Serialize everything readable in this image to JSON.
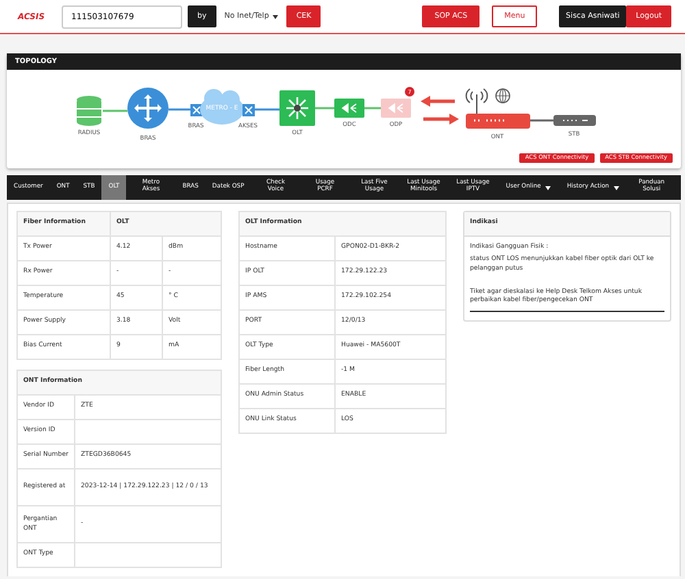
{
  "header": {
    "logo": "ACSIS",
    "search": {
      "value": "111503107679"
    },
    "by_label": "by",
    "select": "No Inet/Telp",
    "check_button": "CEK",
    "sop_button": "SOP ACS",
    "menu_button": "Menu",
    "user": "Sisca Asniwati",
    "logout_button": "Logout"
  },
  "topology": {
    "title": "TOPOLOGY",
    "nodes": [
      {
        "kind": "database",
        "label": "RADIUS",
        "active": true
      },
      {
        "kind": "router",
        "label": "BRAS",
        "active": true
      },
      {
        "kind": "switch",
        "label": "BRAS",
        "active": true
      },
      {
        "kind": "cloud",
        "label": "METRO - E",
        "active": true
      },
      {
        "kind": "switch",
        "label": "AKSES",
        "active": true
      },
      {
        "kind": "olt",
        "label": "OLT",
        "active": true
      },
      {
        "kind": "splitter",
        "label": "ODC",
        "active": true
      },
      {
        "kind": "splitter",
        "label": "ODP",
        "active": false,
        "badge": "7"
      },
      {
        "kind": "ont",
        "label": "ONT",
        "active": true
      },
      {
        "kind": "stb",
        "label": "STB",
        "active": true
      }
    ],
    "buttons": [
      "ACS ONT Connectivity",
      "ACS STB Connectivity"
    ]
  },
  "tabs": [
    {
      "label": "Customer",
      "selected": false,
      "dropdown": false
    },
    {
      "label": "ONT",
      "selected": false,
      "dropdown": false
    },
    {
      "label": "STB",
      "selected": false,
      "dropdown": false
    },
    {
      "label": "OLT",
      "selected": true,
      "dropdown": false
    },
    {
      "label": "Metro Akses",
      "selected": false,
      "dropdown": false
    },
    {
      "label": "BRAS",
      "selected": false,
      "dropdown": false
    },
    {
      "label": "Datek OSP",
      "selected": false,
      "dropdown": false
    },
    {
      "label": "Check Voice",
      "selected": false,
      "dropdown": false
    },
    {
      "label": "Usage PCRF",
      "selected": false,
      "dropdown": false
    },
    {
      "label": "Last Five Usage",
      "selected": false,
      "dropdown": false
    },
    {
      "label": "Last Usage Minitools",
      "selected": false,
      "dropdown": false
    },
    {
      "label": "Last Usage IPTV",
      "selected": false,
      "dropdown": false
    },
    {
      "label": "User Online",
      "selected": false,
      "dropdown": true
    },
    {
      "label": "History Action",
      "selected": false,
      "dropdown": true
    },
    {
      "label": "Panduan Solusi",
      "selected": false,
      "dropdown": false
    }
  ],
  "fiber_information": {
    "title": "Fiber Information",
    "column": "OLT",
    "rows": [
      {
        "label": "Tx Power",
        "value": "4.12",
        "unit": "dBm"
      },
      {
        "label": "Rx Power",
        "value": "-",
        "unit": "-"
      },
      {
        "label": "Temperature",
        "value": "45",
        "unit": "° C"
      },
      {
        "label": "Power Supply",
        "value": "3.18",
        "unit": "Volt"
      },
      {
        "label": "Bias Current",
        "value": "9",
        "unit": "mA"
      }
    ]
  },
  "ont_information": {
    "title": "ONT Information",
    "rows": [
      {
        "label": "Vendor ID",
        "value": "ZTE"
      },
      {
        "label": "Version ID",
        "value": ""
      },
      {
        "label": "Serial Number",
        "value": "ZTEGD36B0645"
      },
      {
        "label": "Registered at",
        "value": "2023-12-14 | 172.29.122.23 | 12 / 0 / 13"
      },
      {
        "label": "Pergantian ONT",
        "value": "-"
      },
      {
        "label": "ONT Type",
        "value": ""
      }
    ]
  },
  "olt_information": {
    "title": "OLT Information",
    "rows": [
      {
        "label": "Hostname",
        "value": "GPON02-D1-BKR-2"
      },
      {
        "label": "IP OLT",
        "value": "172.29.122.23"
      },
      {
        "label": "IP AMS",
        "value": "172.29.102.254"
      },
      {
        "label": "PORT",
        "value": "12/0/13"
      },
      {
        "label": "OLT Type",
        "value": "Huawei - MA5600T"
      },
      {
        "label": "Fiber Length",
        "value": "-1 M"
      },
      {
        "label": "ONU Admin Status",
        "value": "ENABLE"
      },
      {
        "label": "ONU Link Status",
        "value": "LOS"
      }
    ]
  },
  "indikasi": {
    "title": "Indikasi",
    "paragraphs": [
      "Indikasi Gangguan Fisik :",
      "status ONT LOS menunjukkan kabel fiber optik dari OLT ke pelanggan putus",
      "Tiket agar dieskalasi ke Help Desk Telkom Akses untuk perbaikan kabel fiber/pengecekan ONT"
    ]
  }
}
